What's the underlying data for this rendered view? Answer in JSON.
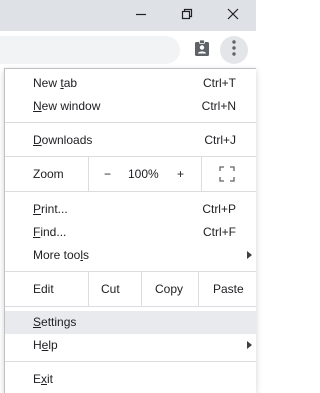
{
  "window_controls": [
    {
      "name": "minimize"
    },
    {
      "name": "restore"
    },
    {
      "name": "close"
    }
  ],
  "toolbar": {
    "profile_icon": "person-badge-icon",
    "menu_icon": "three-dots-vertical-icon"
  },
  "menu": {
    "new_tab": {
      "prefix": "New ",
      "mnemonic": "t",
      "suffix": "ab",
      "shortcut": "Ctrl+T"
    },
    "new_window": {
      "prefix": "",
      "mnemonic": "N",
      "suffix": "ew window",
      "shortcut": "Ctrl+N"
    },
    "downloads": {
      "prefix": "",
      "mnemonic": "D",
      "suffix": "ownloads",
      "shortcut": "Ctrl+J"
    },
    "zoom": {
      "label": "Zoom",
      "minus": "−",
      "level": "100%",
      "plus": "+"
    },
    "print": {
      "prefix": "",
      "mnemonic": "P",
      "suffix": "rint...",
      "shortcut": "Ctrl+P"
    },
    "find": {
      "prefix": "",
      "mnemonic": "F",
      "suffix": "ind...",
      "shortcut": "Ctrl+F"
    },
    "more_tools": {
      "prefix": "More too",
      "mnemonic": "l",
      "suffix": "s"
    },
    "edit": {
      "label": "Edit",
      "cut": "Cut",
      "copy": "Copy",
      "paste": "Paste"
    },
    "settings": {
      "prefix": "",
      "mnemonic": "S",
      "suffix": "ettings"
    },
    "help": {
      "prefix": "H",
      "mnemonic": "e",
      "suffix": "lp"
    },
    "exit": {
      "prefix": "E",
      "mnemonic": "x",
      "suffix": "it"
    }
  }
}
